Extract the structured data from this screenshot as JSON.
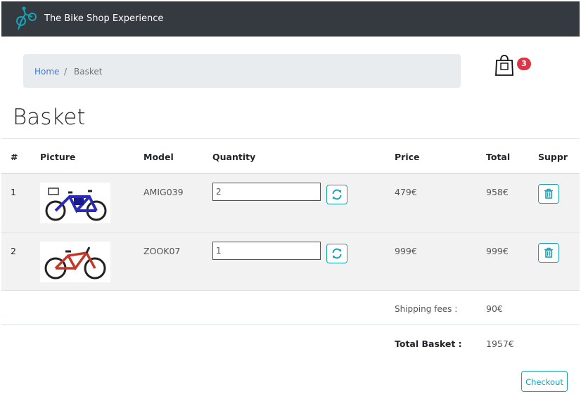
{
  "colors": {
    "navbar": "#343a40",
    "accent": "#17a2b8",
    "badge": "#dc3545",
    "link": "#3b7ddd"
  },
  "navbar": {
    "brand": "The Bike Shop Experience",
    "logo_icon": "bicycle-rider-logo"
  },
  "breadcrumb": {
    "home": "Home",
    "separator": "/",
    "current": "Basket"
  },
  "cart": {
    "icon": "shopping-bag-icon",
    "count": "3"
  },
  "page": {
    "title": "Basket"
  },
  "table": {
    "headers": {
      "num": "#",
      "picture": "Picture",
      "model": "Model",
      "quantity": "Quantity",
      "price": "Price",
      "total": "Total",
      "remove": "Suppr"
    },
    "rows": [
      {
        "num": "1",
        "model": "AMIG039",
        "quantity": "2",
        "price": "479€",
        "total": "958€",
        "image": "blue-electric-bike"
      },
      {
        "num": "2",
        "model": "ZOOK07",
        "quantity": "1",
        "price": "999€",
        "total": "999€",
        "image": "red-black-mountain-bike"
      }
    ]
  },
  "summary": {
    "shipping_label": "Shipping fees :",
    "shipping_value": "90€",
    "total_label": "Total Basket :",
    "total_value": "1957€"
  },
  "actions": {
    "checkout": "Checkout"
  }
}
